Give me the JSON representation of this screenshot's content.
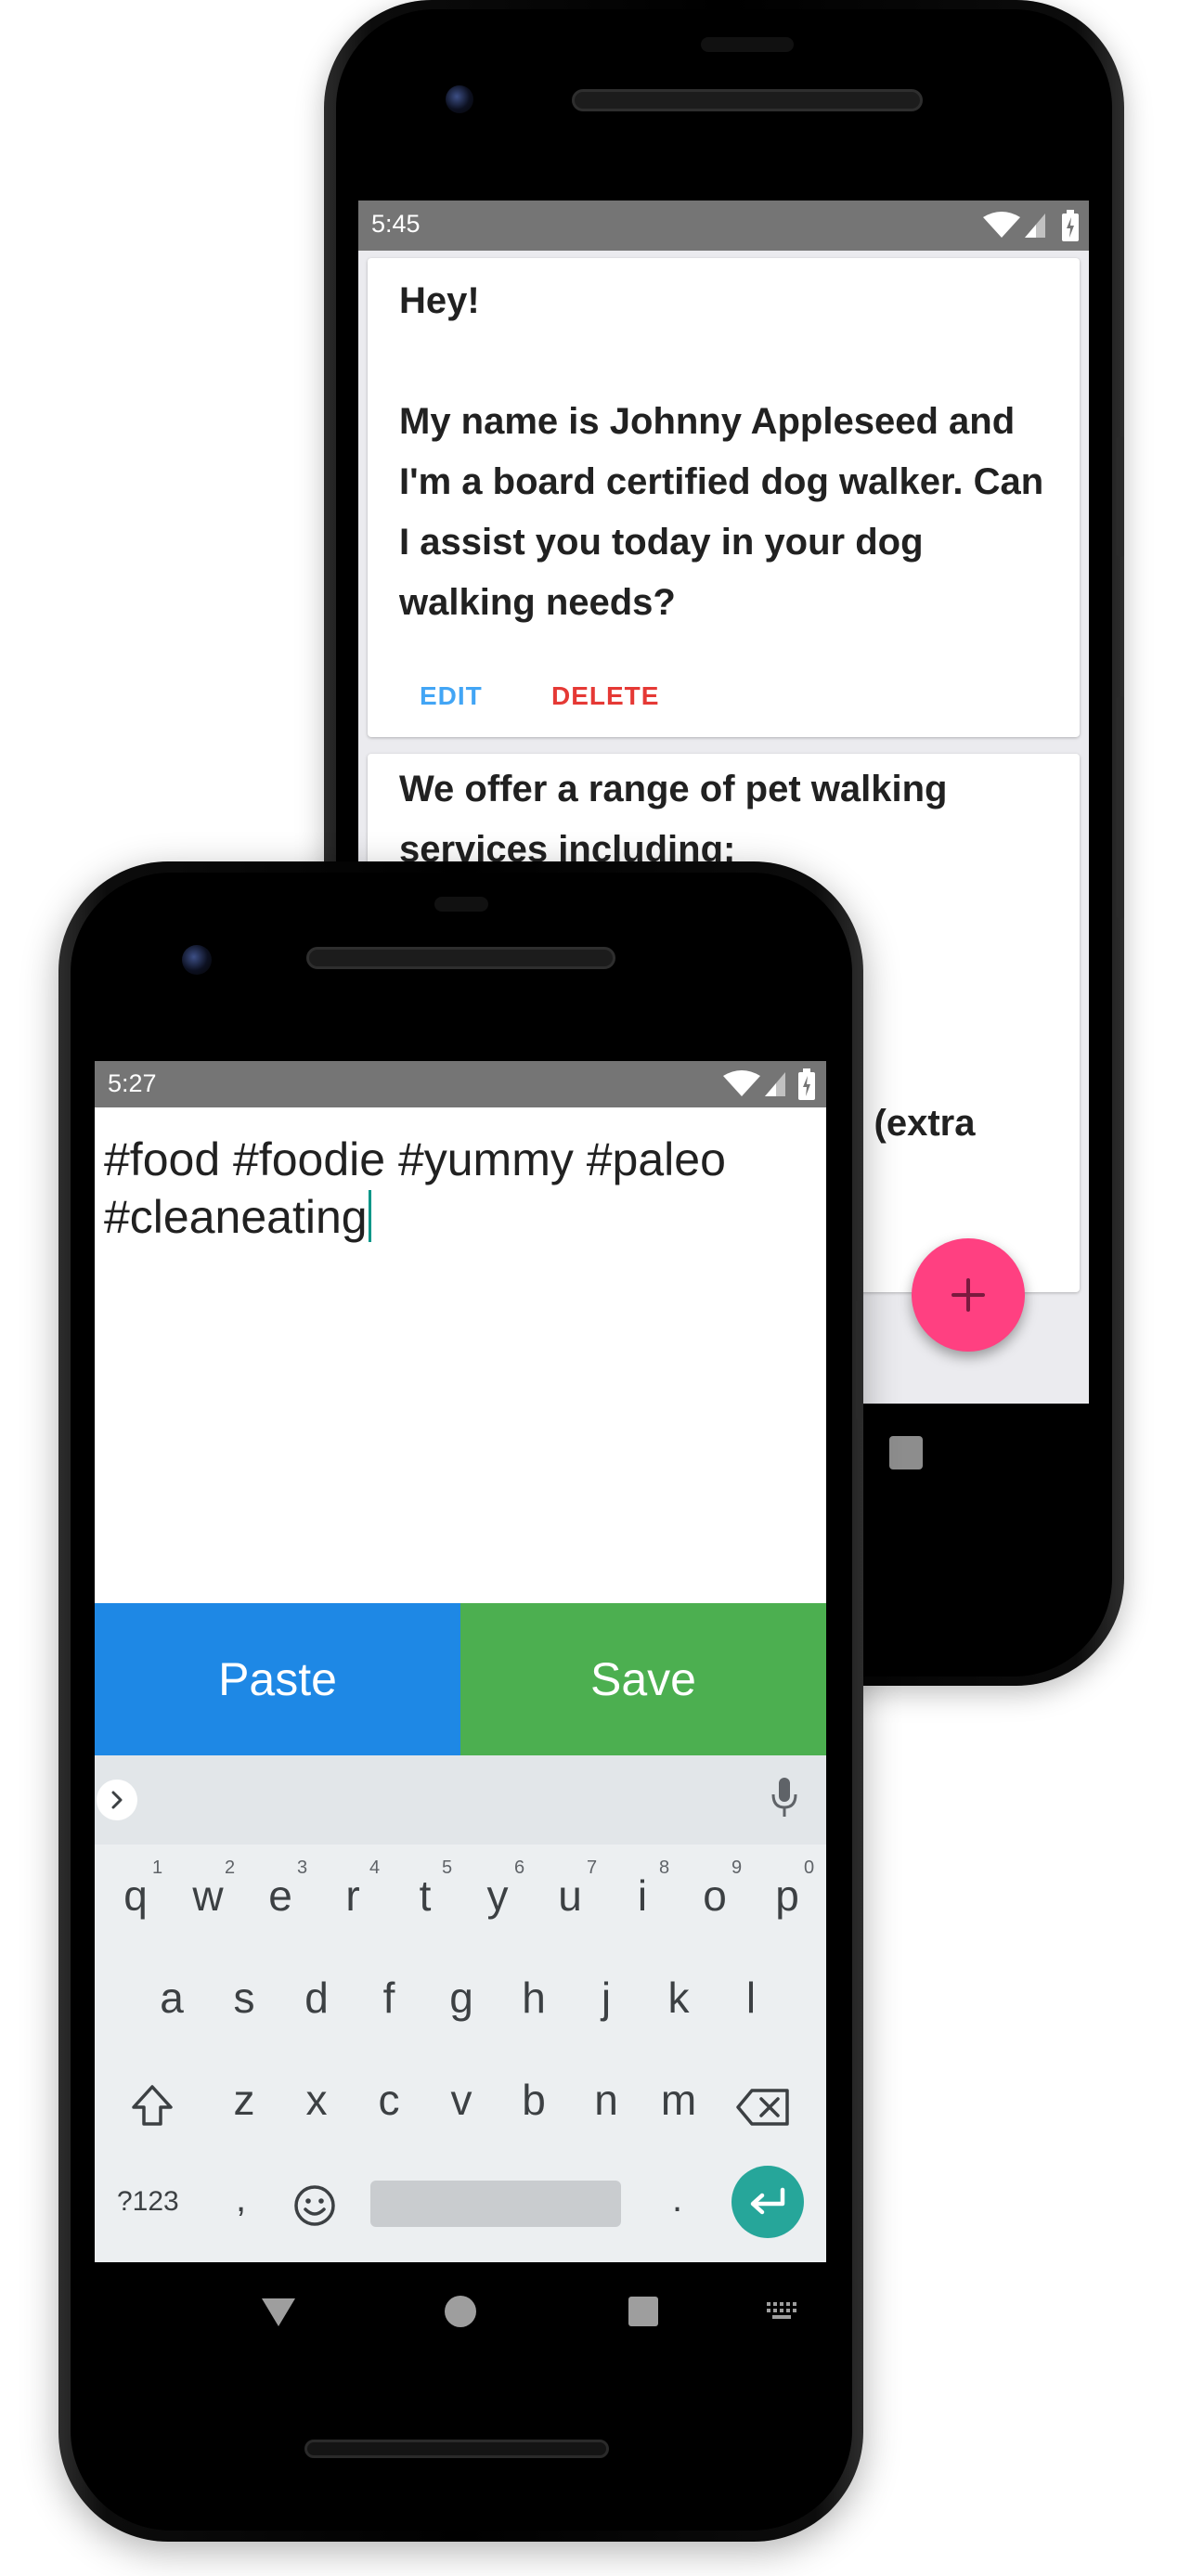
{
  "back_phone": {
    "status_time": "5:45",
    "cards": [
      {
        "text": "Hey!\n\nMy name is Johnny Appleseed and I'm a board certified dog walker. Can I assist you today in your dog walking needs?",
        "edit_label": "EDIT",
        "delete_label": "DELETE"
      },
      {
        "text_line1": "We offer a range of pet walking",
        "text_line2": "services including:",
        "text_fragment": "g (extra"
      }
    ],
    "fab_icon": "plus-icon"
  },
  "front_phone": {
    "status_time": "5:27",
    "editor_text": "#food #foodie #yummy #paleo\n#cleaneating",
    "buttons": {
      "paste_label": "Paste",
      "save_label": "Save"
    },
    "keyboard": {
      "row1": [
        "q",
        "w",
        "e",
        "r",
        "t",
        "y",
        "u",
        "i",
        "o",
        "p"
      ],
      "row1_hints": [
        "1",
        "2",
        "3",
        "4",
        "5",
        "6",
        "7",
        "8",
        "9",
        "0"
      ],
      "row2": [
        "a",
        "s",
        "d",
        "f",
        "g",
        "h",
        "j",
        "k",
        "l"
      ],
      "row3": [
        "z",
        "x",
        "c",
        "v",
        "b",
        "n",
        "m"
      ],
      "symbols_label": "?123",
      "comma": ",",
      "period": "."
    }
  },
  "colors": {
    "status_bar": "#757575",
    "edit": "#42a5f5",
    "delete": "#e53935",
    "fab": "#ff4081",
    "paste": "#1e88e5",
    "save": "#4caf50",
    "enter": "#26a69a"
  }
}
